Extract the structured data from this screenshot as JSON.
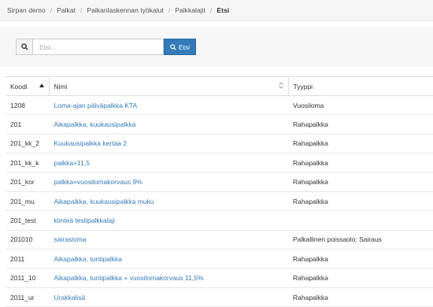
{
  "breadcrumb": [
    "Sirpan demo",
    "Palkat",
    "Palkanlaskennan työkalut",
    "Palkkalajit",
    "Etsi"
  ],
  "search": {
    "placeholder": "Etsi...",
    "button_label": "Etsi",
    "icon": "search-icon",
    "button_color": "#337ab7"
  },
  "table": {
    "headers": {
      "koodi": "Koodi",
      "nimi": "Nimi",
      "tyyppi": "Tyyppi"
    },
    "rows": [
      {
        "koodi": "1208",
        "nimi": "Loma-ajan päiväpalkka KTA",
        "tyyppi": "Vuosiloma"
      },
      {
        "koodi": "201",
        "nimi": "Aikapalkka, kuukausipalkka",
        "tyyppi": "Rahapalkka"
      },
      {
        "koodi": "201_kk_2",
        "nimi": "Kuukausipalkka kertaa 2",
        "tyyppi": "Rahapalkka"
      },
      {
        "koodi": "201_kk_k",
        "nimi": "palkka+11,5",
        "tyyppi": "Rahapalkka"
      },
      {
        "koodi": "201_kor",
        "nimi": "palkka+vuosilomakorvaus 9%",
        "tyyppi": "Rahapalkka"
      },
      {
        "koodi": "201_mu",
        "nimi": "Aikapalkka, kuukausipalkka muku",
        "tyyppi": "Rahapalkka"
      },
      {
        "koodi": "201_test",
        "nimi": "kiinteä testipalkkalaji",
        "tyyppi": ""
      },
      {
        "koodi": "201010",
        "nimi": "sairasloma",
        "tyyppi": "Palkallinen poissaolo: Sairaus"
      },
      {
        "koodi": "2011",
        "nimi": "Aikapalkka, tuntipalkka",
        "tyyppi": "Rahapalkka"
      },
      {
        "koodi": "2011_10",
        "nimi": "Aikapalkka, tuntipalkka + vuosilomakorvaus 11,5%",
        "tyyppi": "Rahapalkka"
      },
      {
        "koodi": "2011_ur",
        "nimi": "Urakkalisä",
        "tyyppi": "Rahapalkka"
      }
    ]
  }
}
